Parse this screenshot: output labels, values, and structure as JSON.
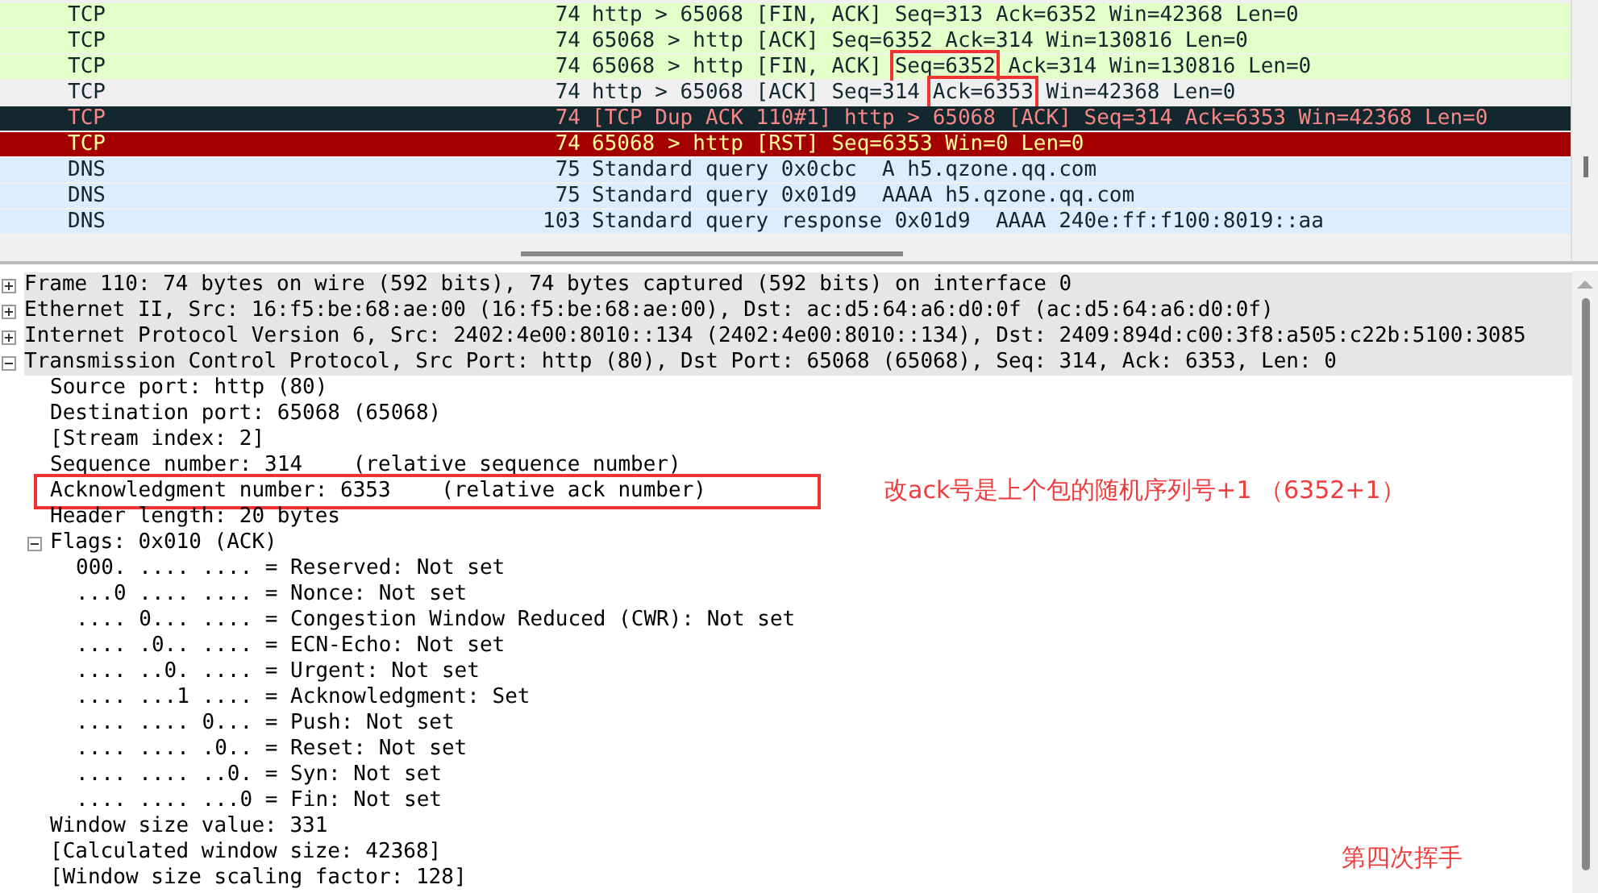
{
  "packets": [
    {
      "kind": "fin",
      "protocol": "TCP",
      "length": "74",
      "info": [
        {
          "text": "http > 65068 [FIN, ACK] Seq=313 Ack=6352 Win=42368 Len=0",
          "boxed": false
        }
      ]
    },
    {
      "kind": "fin",
      "protocol": "TCP",
      "length": "74",
      "info": [
        {
          "text": "65068 > http [ACK] Seq=6352 Ack=314 Win=130816 Len=0",
          "boxed": false
        }
      ]
    },
    {
      "kind": "fin",
      "protocol": "TCP",
      "length": "74",
      "info": [
        {
          "text": "65068 > http [FIN, ACK] ",
          "boxed": false
        },
        {
          "text": "Seq=6352",
          "boxed": true
        },
        {
          "text": " Ack=314 Win=130816 Len=0",
          "boxed": false
        }
      ]
    },
    {
      "kind": "ack",
      "protocol": "TCP",
      "length": "74",
      "info": [
        {
          "text": "http > 65068 [ACK] Seq=314 ",
          "boxed": false
        },
        {
          "text": "Ack=6353",
          "boxed": true
        },
        {
          "text": " Win=42368 Len=0",
          "boxed": false
        }
      ]
    },
    {
      "kind": "dup",
      "protocol": "TCP",
      "length": "74",
      "info": [
        {
          "text": "[TCP Dup ACK 110#1] http > 65068 [ACK] Seq=314 Ack=6353 Win=42368 Len=0",
          "boxed": false
        }
      ]
    },
    {
      "kind": "rst",
      "protocol": "TCP",
      "length": "74",
      "info": [
        {
          "text": "65068 > http [RST] Seq=6353 Win=0 Len=0",
          "boxed": false
        }
      ]
    },
    {
      "kind": "dns",
      "protocol": "DNS",
      "length": "75",
      "info": [
        {
          "text": "Standard query 0x0cbc  A h5.qzone.qq.com",
          "boxed": false
        }
      ]
    },
    {
      "kind": "dns",
      "protocol": "DNS",
      "length": "75",
      "info": [
        {
          "text": "Standard query 0x01d9  AAAA h5.qzone.qq.com",
          "boxed": false
        }
      ]
    },
    {
      "kind": "dns",
      "protocol": "DNS",
      "length": "103",
      "info": [
        {
          "text": "Standard query response 0x01d9  AAAA 240e:ff:f100:8019::aa",
          "boxed": false
        }
      ]
    }
  ],
  "details": [
    {
      "text": "Frame 110: 74 bytes on wire (592 bits), 74 bytes captured (592 bits) on interface 0",
      "expanded": false
    },
    {
      "text": "Ethernet II, Src: 16:f5:be:68:ae:00 (16:f5:be:68:ae:00), Dst: ac:d5:64:a6:d0:0f (ac:d5:64:a6:d0:0f)",
      "expanded": false
    },
    {
      "text": "Internet Protocol Version 6, Src: 2402:4e00:8010::134 (2402:4e00:8010::134), Dst: 2409:894d:c00:3f8:a505:c22b:5100:3085",
      "expanded": false
    },
    {
      "text": "Transmission Control Protocol, Src Port: http (80), Dst Port: 65068 (65068), Seq: 314, Ack: 6353, Len: 0",
      "expanded": true,
      "children": [
        {
          "text": "Source port: http (80)"
        },
        {
          "text": "Destination port: 65068 (65068)"
        },
        {
          "text": "[Stream index: 2]"
        },
        {
          "text": "Sequence number: 314    (relative sequence number)"
        },
        {
          "text": "Acknowledgment number: 6353    (relative ack number)",
          "boxed": true
        },
        {
          "text": "Header length: 20 bytes"
        },
        {
          "text": "Flags: 0x010 (ACK)",
          "expanded": true,
          "children": [
            {
              "text": "000. .... .... = Reserved: Not set"
            },
            {
              "text": "...0 .... .... = Nonce: Not set"
            },
            {
              "text": ".... 0... .... = Congestion Window Reduced (CWR): Not set"
            },
            {
              "text": ".... .0.. .... = ECN-Echo: Not set"
            },
            {
              "text": ".... ..0. .... = Urgent: Not set"
            },
            {
              "text": ".... ...1 .... = Acknowledgment: Set"
            },
            {
              "text": ".... .... 0... = Push: Not set"
            },
            {
              "text": ".... .... .0.. = Reset: Not set"
            },
            {
              "text": ".... .... ..0. = Syn: Not set"
            },
            {
              "text": ".... .... ...0 = Fin: Not set"
            }
          ]
        },
        {
          "text": "Window size value: 331"
        },
        {
          "text": "[Calculated window size: 42368]"
        },
        {
          "text": "[Window size scaling factor: 128]"
        }
      ]
    }
  ],
  "annotations": [
    {
      "text": "改ack号是上个包的随机序列号+1 （6352+1）"
    },
    {
      "text": "第四次挥手"
    }
  ]
}
